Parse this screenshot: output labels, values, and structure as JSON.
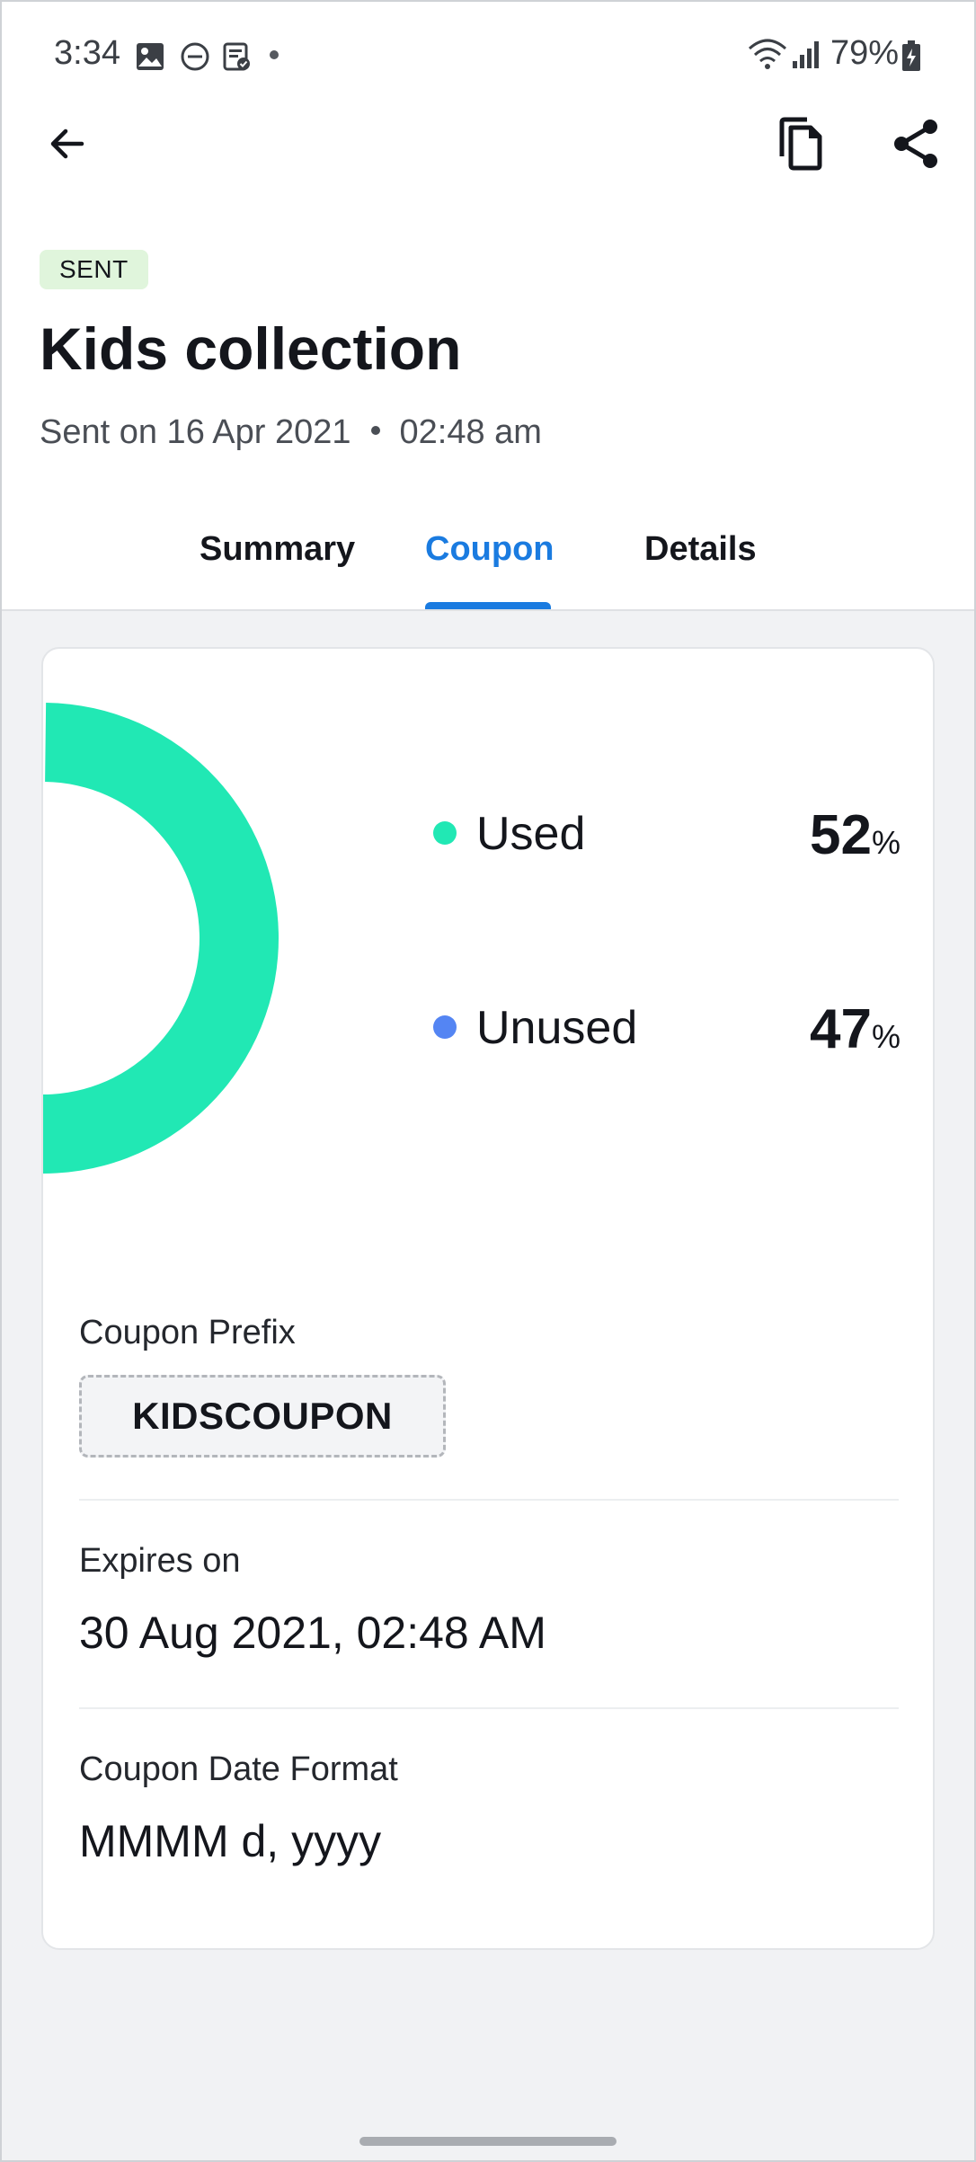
{
  "status_bar": {
    "time": "3:34",
    "battery": "79%",
    "icons": [
      "image-icon",
      "do-not-disturb-icon",
      "clipboard-check-icon",
      "notification-dot",
      "wifi-icon",
      "signal-icon",
      "battery-charging-icon"
    ]
  },
  "app_bar": {
    "back_icon": "arrow-left-icon",
    "actions": [
      "copy-icon",
      "share-icon"
    ]
  },
  "campaign": {
    "status": "SENT",
    "title": "Kids collection",
    "sent_date": "Sent on 16 Apr 2021",
    "sent_time": "02:48 am"
  },
  "tabs": [
    {
      "label": "Summary",
      "active": false
    },
    {
      "label": "Coupon",
      "active": true
    },
    {
      "label": "Details",
      "active": false
    }
  ],
  "chart_data": {
    "type": "pie",
    "categories": [
      "Used",
      "Unused"
    ],
    "values": [
      52,
      47
    ],
    "unit": "%",
    "colors": [
      "#21e8b4",
      "#5485f3"
    ]
  },
  "legend": [
    {
      "label": "Used",
      "value": "52",
      "unit": "%",
      "color": "#21e8b4"
    },
    {
      "label": "Unused",
      "value": "47",
      "unit": "%",
      "color": "#5485f3"
    }
  ],
  "coupon": {
    "prefix_label": "Coupon Prefix",
    "prefix_value": "KIDSCOUPON",
    "expires_label": "Expires on",
    "expires_value": "30 Aug 2021, 02:48 AM",
    "date_format_label": "Coupon Date Format",
    "date_format_value": "MMMM d, yyyy"
  },
  "colors": {
    "accent": "#1a7be0",
    "badge_bg": "#e0f5dc",
    "background": "#f1f2f4"
  }
}
